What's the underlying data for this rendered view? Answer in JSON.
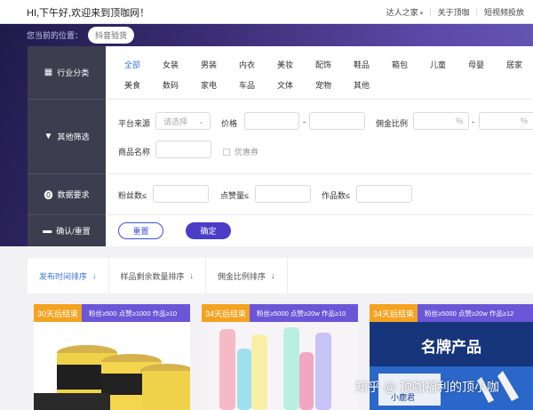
{
  "header": {
    "greeting": "HI,下午好,欢迎来到顶咖网！",
    "nav": [
      {
        "label": "达人之家",
        "has_caret": true
      },
      {
        "label": "关于顶咖"
      },
      {
        "label": "短视频投放"
      }
    ]
  },
  "breadcrumb": {
    "prefix": "您当前的位置：",
    "current": "抖音验货"
  },
  "sidebar": {
    "industry": "行业分类",
    "filter": "其他筛选",
    "data_req": "数据要求",
    "confirm": "确认/重置"
  },
  "categories": {
    "row1": [
      "全部",
      "女装",
      "男装",
      "内衣",
      "美妆",
      "配饰",
      "鞋品",
      "箱包",
      "儿童",
      "母婴",
      "居家"
    ],
    "row2": [
      "美食",
      "数码",
      "家电",
      "车品",
      "文体",
      "宠物",
      "其他"
    ],
    "active": "全部"
  },
  "filters": {
    "platform_label": "平台来源",
    "platform_placeholder": "请选择",
    "price_label": "价格",
    "price_dash": "-",
    "commission_label": "佣金比例",
    "percent": "%",
    "product_name_label": "商品名称",
    "coupon_label": "优惠券"
  },
  "data_requirements": {
    "fans_label": "粉丝数≤",
    "likes_label": "点赞量≤",
    "works_label": "作品数≤"
  },
  "buttons": {
    "reset": "重置",
    "confirm": "确定"
  },
  "sort": [
    {
      "label": "发布时间排序",
      "arrow": "↓",
      "active": true
    },
    {
      "label": "样品剩余数量排序",
      "arrow": "↓"
    },
    {
      "label": "佣金比例排序",
      "arrow": "↓"
    }
  ],
  "cards": [
    {
      "ends": "30天后结束",
      "stats": "粉丝≥500 点赞≥1000 作品≥10"
    },
    {
      "ends": "34天后结束",
      "stats": "粉丝≥5000 点赞≥20w 作品≥10"
    },
    {
      "ends": "34天后结束",
      "stats": "粉丝≥5000 点赞≥20w 作品≥12"
    }
  ],
  "card3_overlay": {
    "headline": "名牌产品",
    "brand": "小鹿君"
  },
  "watermark": "知乎 @ 顶咖福利的顶小咖",
  "colors": {
    "accent": "#3b74d6",
    "purple": "#4a3ec9",
    "banner": "#3a2d74",
    "sidebar": "#3c3d4e",
    "ends_badge": "#f4a321"
  }
}
